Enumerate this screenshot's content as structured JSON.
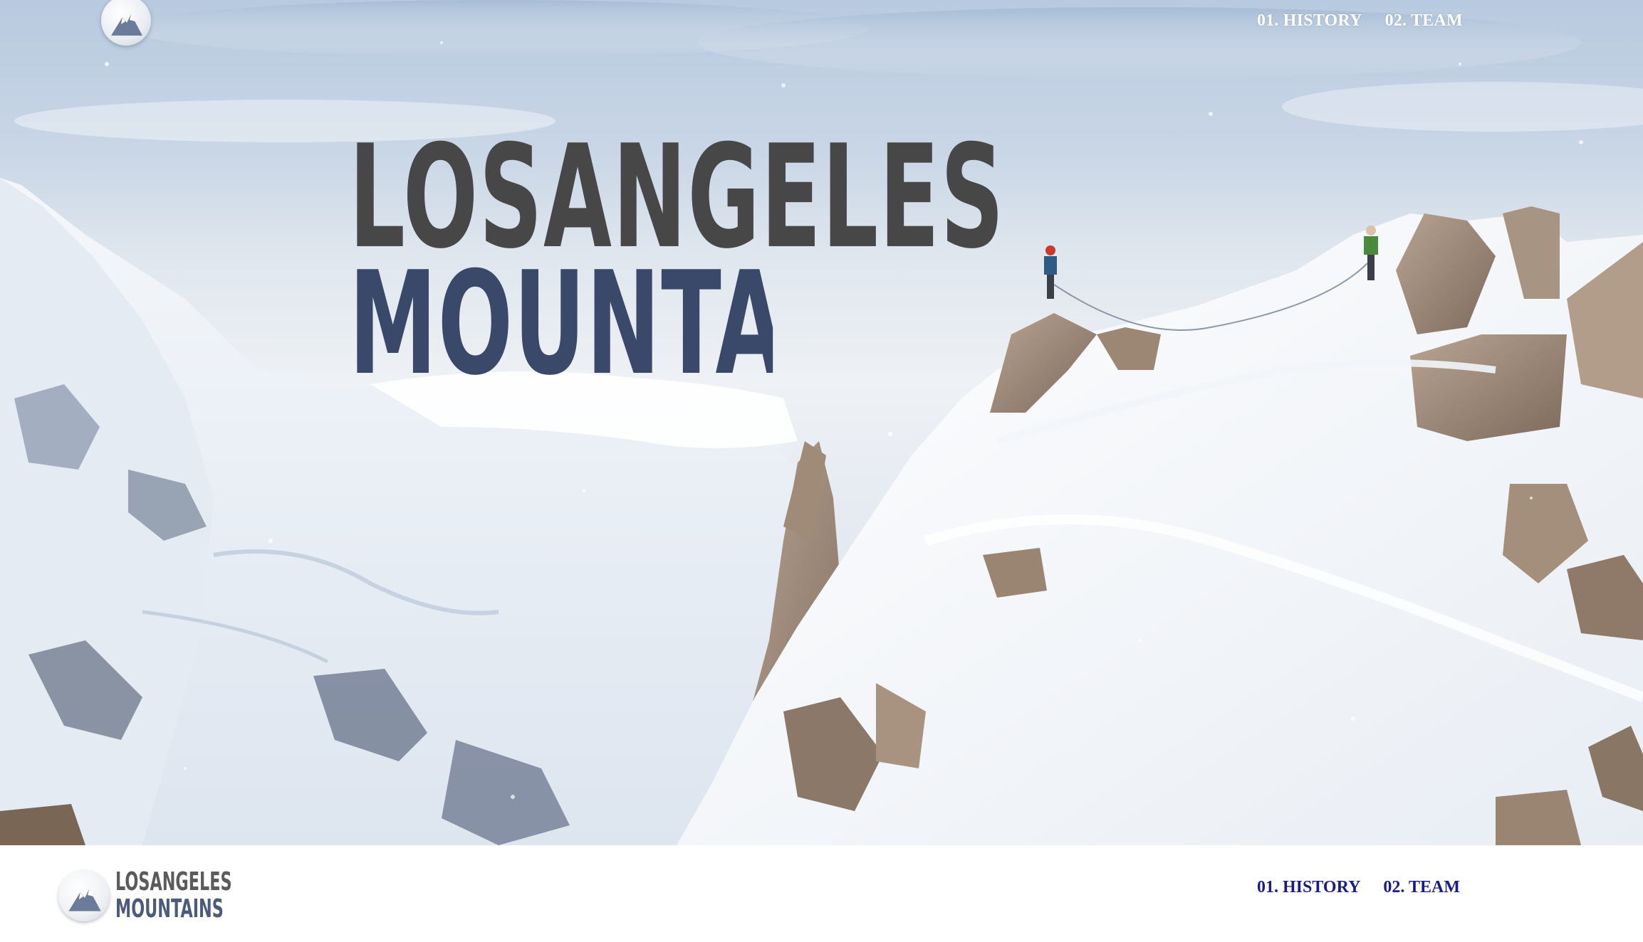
{
  "header": {
    "logo_icon": "mountain-logo-icon",
    "nav": [
      {
        "label": "01. HISTORY"
      },
      {
        "label": "02. TEAM"
      }
    ]
  },
  "hero": {
    "title_line_1": "LOSANGELES",
    "title_line_2": "MOUNTAINS",
    "title_color_1": "#474747",
    "title_color_2": "#3a4869"
  },
  "footer": {
    "logo_icon": "mountain-logo-icon",
    "wordmark_line_1": "LOSANGELES",
    "wordmark_line_2": "MOUNTAINS",
    "nav": [
      {
        "label": "01. HISTORY"
      },
      {
        "label": "02. TEAM"
      }
    ],
    "nav_color": "#1a1a8c"
  }
}
